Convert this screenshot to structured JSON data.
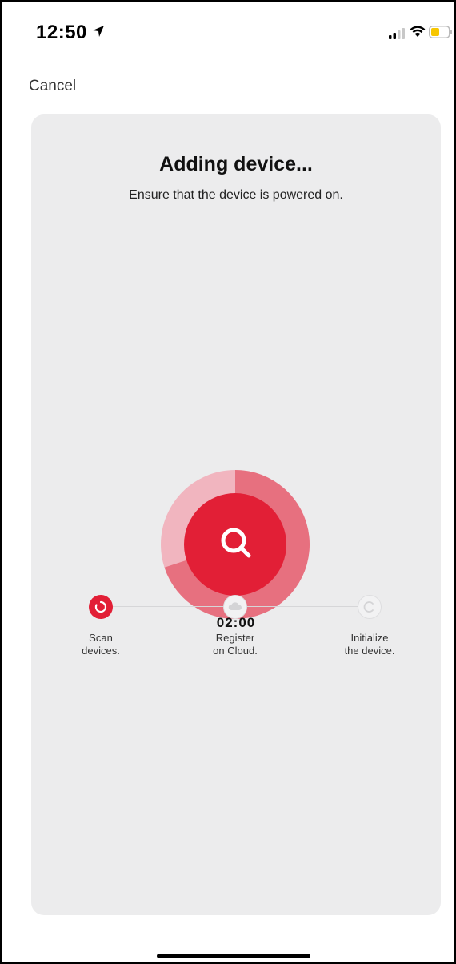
{
  "status_bar": {
    "time": "12:50"
  },
  "nav": {
    "cancel_label": "Cancel"
  },
  "main": {
    "title": "Adding device...",
    "subtitle": "Ensure that the device is powered on.",
    "timer": "02:00",
    "progress": 0.3,
    "accent_color": "#e21f36"
  },
  "steps": [
    {
      "line1": "Scan",
      "line2": "devices.",
      "state": "active",
      "icon": "spinner-icon"
    },
    {
      "line1": "Register",
      "line2": "on Cloud.",
      "state": "pending",
      "icon": "cloud-icon"
    },
    {
      "line1": "Initialize",
      "line2": "the device.",
      "state": "pending",
      "icon": "initialize-icon"
    }
  ]
}
